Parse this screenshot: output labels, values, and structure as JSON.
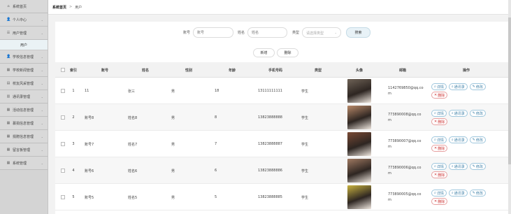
{
  "sidebar": {
    "items": [
      {
        "label": "系统首页",
        "icon": "home-icon",
        "glyph": "⌂"
      },
      {
        "label": "个人中心",
        "icon": "person-icon",
        "glyph": "👤"
      },
      {
        "label": "用户管理",
        "icon": "menu-icon",
        "glyph": "☰"
      },
      {
        "label": "学校信息管理",
        "icon": "person-icon",
        "glyph": "👤"
      },
      {
        "label": "学校新闻管理",
        "icon": "grid-icon",
        "glyph": "▦"
      },
      {
        "label": "校友风采管理",
        "icon": "doc-icon",
        "glyph": "▤"
      },
      {
        "label": "通讯录管理",
        "icon": "chart-icon",
        "glyph": "▥"
      },
      {
        "label": "活动信息管理",
        "icon": "table-icon",
        "glyph": "▦"
      },
      {
        "label": "募捐信息管理",
        "icon": "table-icon",
        "glyph": "▦"
      },
      {
        "label": "捐赠信息管理",
        "icon": "table-icon",
        "glyph": "▦"
      },
      {
        "label": "留言板管理",
        "icon": "grid-icon",
        "glyph": "▦"
      },
      {
        "label": "系统管理",
        "icon": "grid-icon",
        "glyph": "▦"
      }
    ],
    "sub_item": "用户"
  },
  "breadcrumb": {
    "home": "系统首页",
    "sep": ">",
    "current": "用户"
  },
  "search": {
    "account_label": "账号",
    "account_placeholder": "账号",
    "name_label": "姓名",
    "name_placeholder": "姓名",
    "type_label": "类型",
    "type_placeholder": "请选择类型",
    "search_button": "搜索"
  },
  "actions": {
    "add": "新增",
    "delete": "删除"
  },
  "table": {
    "headers": [
      "索引",
      "账号",
      "姓名",
      "性别",
      "年龄",
      "手机号码",
      "类型",
      "头像",
      "邮箱",
      "操作"
    ],
    "rows": [
      {
        "idx": "1",
        "account": "11",
        "name": "张三",
        "gender": "男",
        "age": "18",
        "phone": "13111111111",
        "type": "学生",
        "email": "1142769850@qq.com",
        "avatar_color": "#6f6357"
      },
      {
        "idx": "2",
        "account": "账号8",
        "name": "姓名8",
        "gender": "男",
        "age": "8",
        "phone": "13823888888",
        "type": "学生",
        "email": "773890008@qq.com",
        "avatar_color": "#b98a6a"
      },
      {
        "idx": "3",
        "account": "账号7",
        "name": "姓名7",
        "gender": "男",
        "age": "7",
        "phone": "13823888887",
        "type": "学生",
        "email": "773890007@qq.com",
        "avatar_color": "#7a4a35"
      },
      {
        "idx": "4",
        "account": "账号6",
        "name": "姓名6",
        "gender": "男",
        "age": "6",
        "phone": "13823888886",
        "type": "学生",
        "email": "773890006@qq.com",
        "avatar_color": "#a07a62"
      },
      {
        "idx": "5",
        "account": "账号5",
        "name": "姓名5",
        "gender": "男",
        "age": "5",
        "phone": "13823888885",
        "type": "学生",
        "email": "773890005@qq.com",
        "avatar_color": "#c9b340"
      }
    ],
    "ops": {
      "detail": "详情",
      "contacts": "通讯录",
      "edit": "修改",
      "delete": "删除"
    }
  }
}
